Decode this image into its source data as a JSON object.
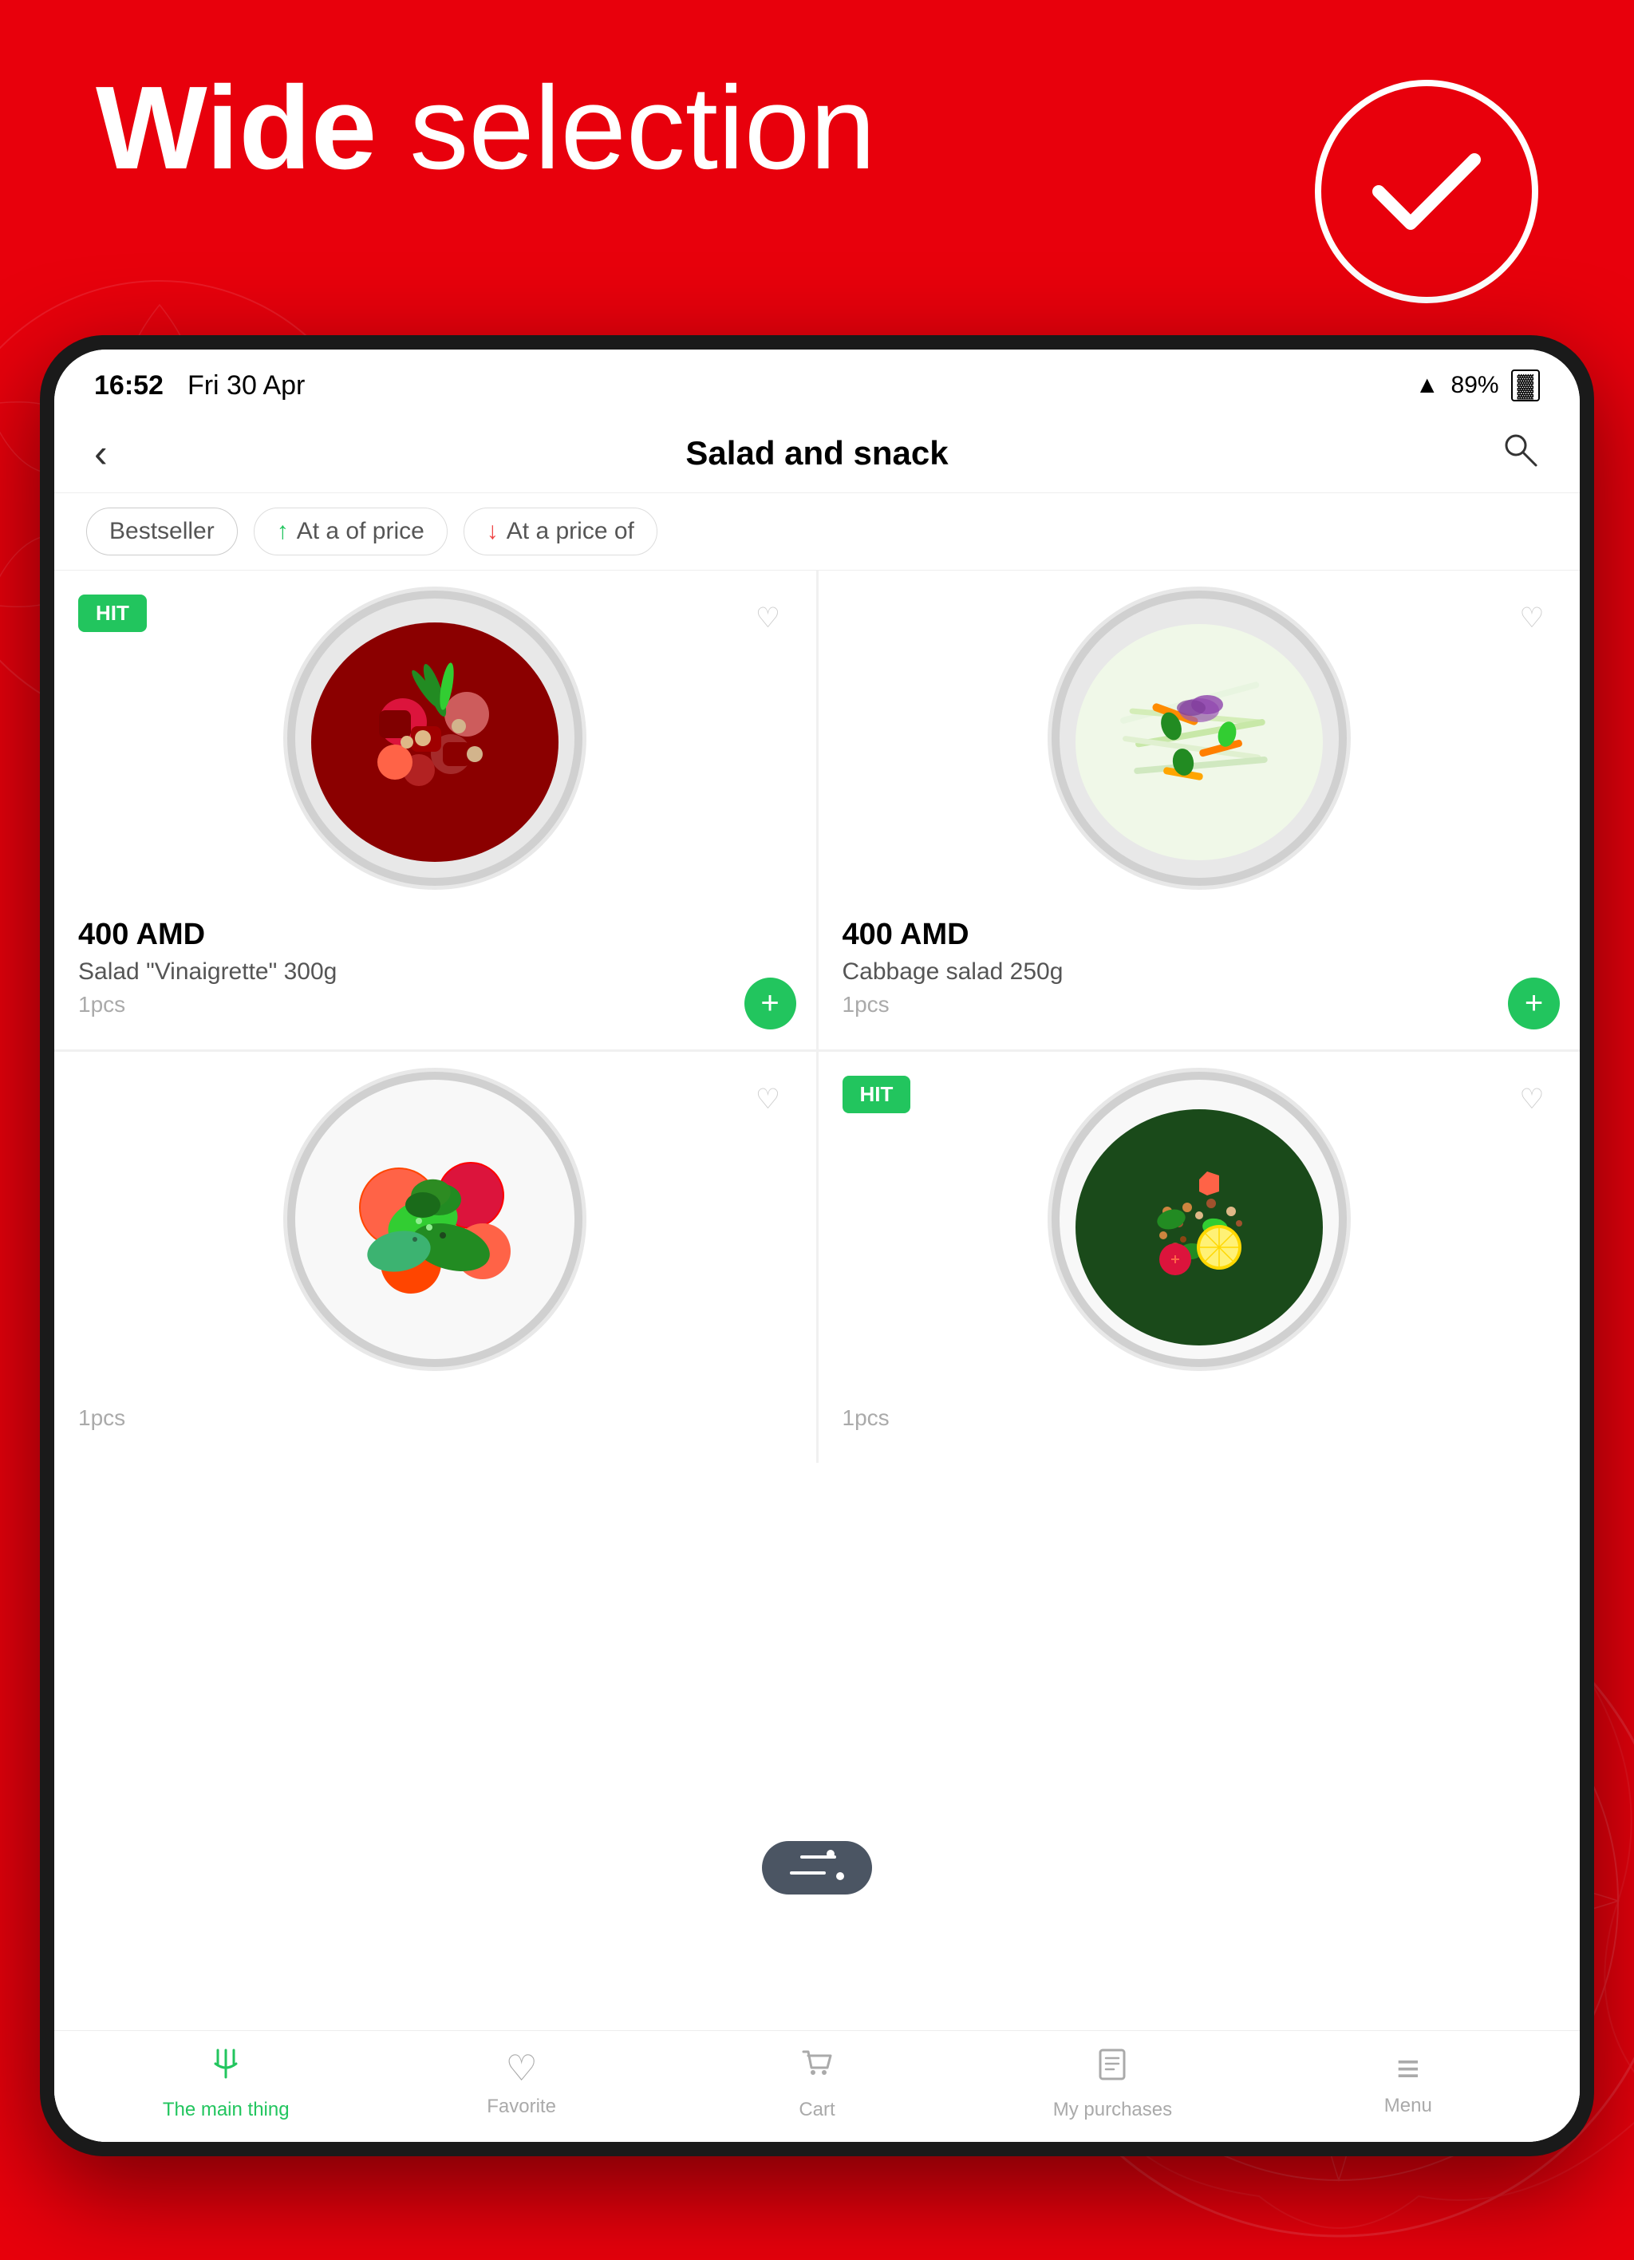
{
  "header": {
    "title_bold": "Wide",
    "title_normal": " selection"
  },
  "status_bar": {
    "time": "16:52",
    "date": "Fri 30 Apr",
    "battery_pct": "89%"
  },
  "nav": {
    "title": "Salad and snack",
    "back_icon": "‹",
    "search_icon": "🔍"
  },
  "filters": [
    {
      "label": "Bestseller",
      "active": true,
      "has_arrow": false
    },
    {
      "label": "At a of price",
      "active": false,
      "has_arrow": true,
      "arrow": "↑"
    },
    {
      "label": "At a price of",
      "active": false,
      "has_arrow": true,
      "arrow": "↓"
    }
  ],
  "products": [
    {
      "id": 1,
      "price": "400 AMD",
      "name": "Salad \"Vinaigrette\" 300g",
      "qty": "1pcs",
      "hit": true,
      "favorited": false,
      "food_type": "vinaigrette"
    },
    {
      "id": 2,
      "price": "400 AMD",
      "name": "Cabbage salad 250g",
      "qty": "1pcs",
      "hit": false,
      "favorited": false,
      "food_type": "cabbage"
    },
    {
      "id": 3,
      "price": "",
      "name": "",
      "qty": "1pcs",
      "hit": false,
      "favorited": false,
      "food_type": "salad"
    },
    {
      "id": 4,
      "price": "",
      "name": "",
      "qty": "1pcs",
      "hit": true,
      "favorited": false,
      "food_type": "tabbouleh"
    }
  ],
  "tabs": [
    {
      "id": "main",
      "label": "The main thing",
      "icon": "🍴",
      "active": true
    },
    {
      "id": "favorite",
      "label": "Favorite",
      "icon": "♡",
      "active": false
    },
    {
      "id": "cart",
      "label": "Cart",
      "icon": "🛒",
      "active": false
    },
    {
      "id": "purchases",
      "label": "My purchases",
      "icon": "🧾",
      "active": false
    },
    {
      "id": "menu",
      "label": "Menu",
      "icon": "≡",
      "active": false
    }
  ],
  "badges": {
    "hit": "HIT"
  },
  "add_btn_label": "+",
  "colors": {
    "red": "#E8000C",
    "green": "#22c55e",
    "white": "#ffffff"
  }
}
